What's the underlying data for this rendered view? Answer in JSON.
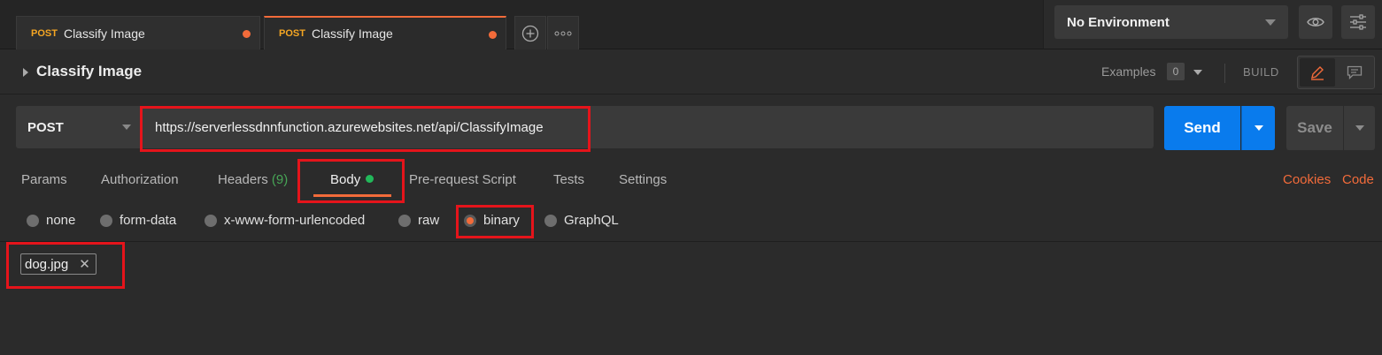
{
  "tabs": [
    {
      "method": "POST",
      "title": "Classify Image",
      "active": false
    },
    {
      "method": "POST",
      "title": "Classify Image",
      "active": true
    }
  ],
  "tab_actions": {
    "new_tab_icon": "plus-circle-icon",
    "more_icon": "more-dots-icon"
  },
  "environment": {
    "selected": "No Environment"
  },
  "request": {
    "title": "Classify Image",
    "examples_label": "Examples",
    "examples_count": "0",
    "build_label": "BUILD"
  },
  "url_bar": {
    "method": "POST",
    "url": "https://serverlessdnnfunction.azurewebsites.net/api/ClassifyImage",
    "send_label": "Send",
    "save_label": "Save"
  },
  "request_tabs": {
    "params": "Params",
    "authorization": "Authorization",
    "headers": "Headers",
    "headers_count": "(9)",
    "body": "Body",
    "pre_request": "Pre-request Script",
    "tests": "Tests",
    "settings": "Settings",
    "cookies": "Cookies",
    "code": "Code"
  },
  "body_types": {
    "none": "none",
    "form_data": "form-data",
    "urlencoded": "x-www-form-urlencoded",
    "raw": "raw",
    "binary": "binary",
    "graphql": "GraphQL",
    "selected": "binary"
  },
  "file": {
    "name": "dog.jpg"
  },
  "colors": {
    "accent": "#f26b3a",
    "send_blue": "#097bed",
    "highlight_red": "#e5141b",
    "status_green": "#22b85a"
  }
}
